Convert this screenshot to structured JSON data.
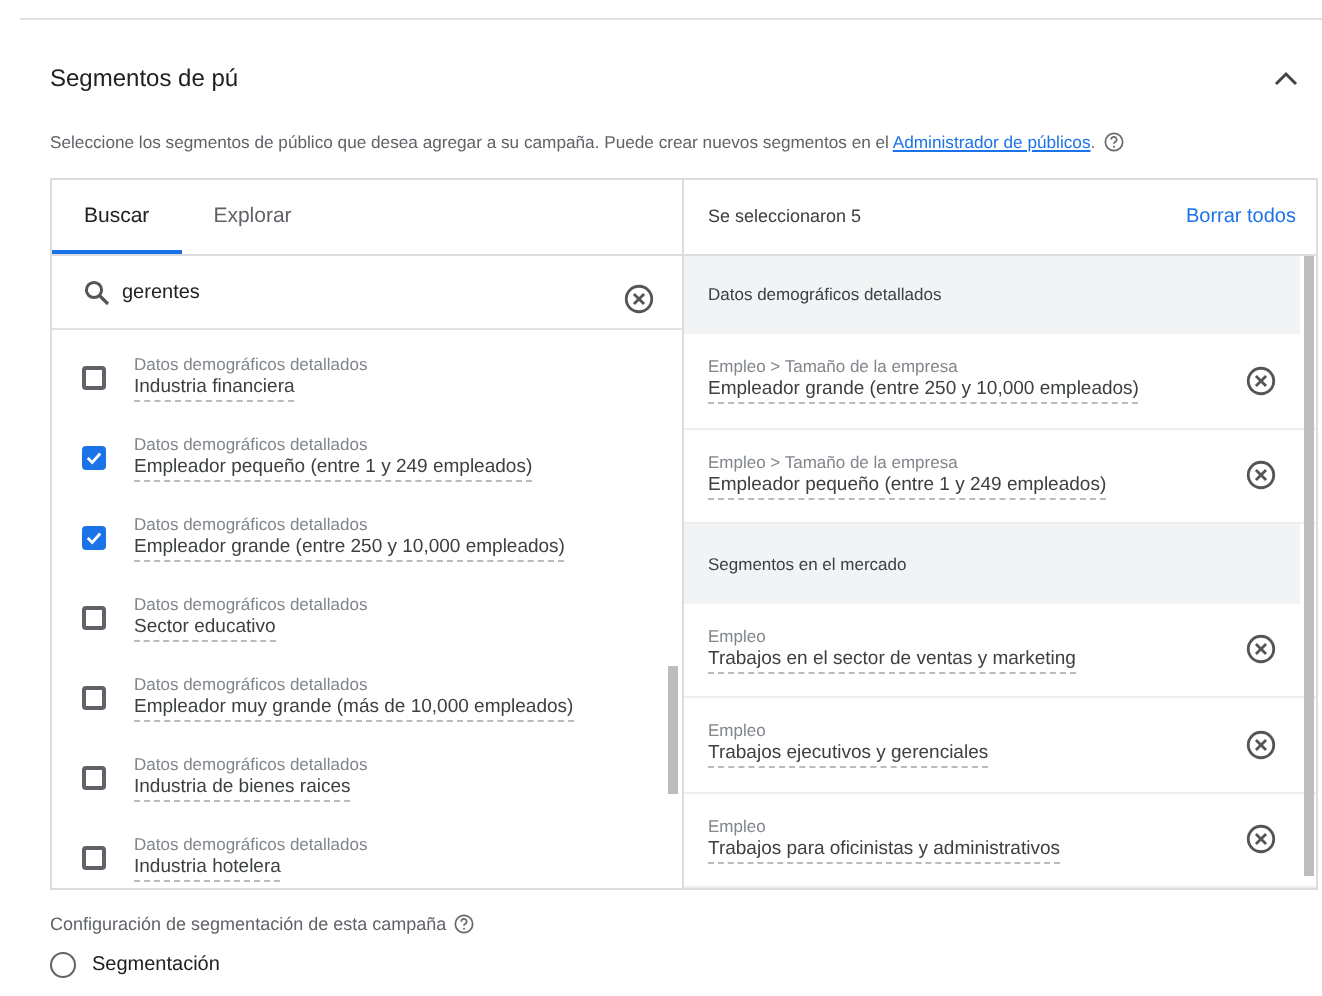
{
  "section": {
    "title": "Segmentos de pú",
    "expanded": true,
    "description_before": "Seleccione los segmentos de público que desea agregar a su campaña. Puede crear nuevos segmentos en el ",
    "description_link": "Administrador de públicos",
    "description_after": "."
  },
  "tabs": [
    {
      "label": "Buscar",
      "selected": true
    },
    {
      "label": "Explorar",
      "selected": false
    }
  ],
  "search": {
    "value": "gerentes"
  },
  "results": [
    {
      "category": "Datos demográficos detallados",
      "name": "Industria financiera",
      "checked": false
    },
    {
      "category": "Datos demográficos detallados",
      "name": "Empleador pequeño (entre 1 y 249 empleados)",
      "checked": true
    },
    {
      "category": "Datos demográficos detallados",
      "name": "Empleador grande (entre 250 y 10,000 empleados)",
      "checked": true
    },
    {
      "category": "Datos demográficos detallados",
      "name": "Sector educativo",
      "checked": false
    },
    {
      "category": "Datos demográficos detallados",
      "name": "Empleador muy grande (más de 10,000 empleados)",
      "checked": false
    },
    {
      "category": "Datos demográficos detallados",
      "name": "Industria de bienes raices",
      "checked": false
    },
    {
      "category": "Datos demográficos detallados",
      "name": "Industria hotelera",
      "checked": false
    }
  ],
  "selected_panel": {
    "count_label": "Se seleccionaron 5",
    "clear_all": "Borrar todos",
    "groups": [
      {
        "title": "Datos demográficos detallados",
        "items": [
          {
            "path": "Empleo > Tamaño de la empresa",
            "name": "Empleador grande (entre 250 y 10,000 empleados)"
          },
          {
            "path": "Empleo > Tamaño de la empresa",
            "name": "Empleador pequeño (entre 1 y 249 empleados)"
          }
        ]
      },
      {
        "title": "Segmentos en el mercado",
        "items": [
          {
            "path": "Empleo",
            "name": "Trabajos en el sector de ventas y marketing"
          },
          {
            "path": "Empleo",
            "name": "Trabajos ejecutivos y gerenciales"
          },
          {
            "path": "Empleo",
            "name": "Trabajos para oficinistas y administrativos"
          }
        ]
      }
    ]
  },
  "targeting": {
    "label": "Configuración de segmentación de esta campaña",
    "options": [
      {
        "label": "Segmentación",
        "selected": false
      }
    ]
  }
}
